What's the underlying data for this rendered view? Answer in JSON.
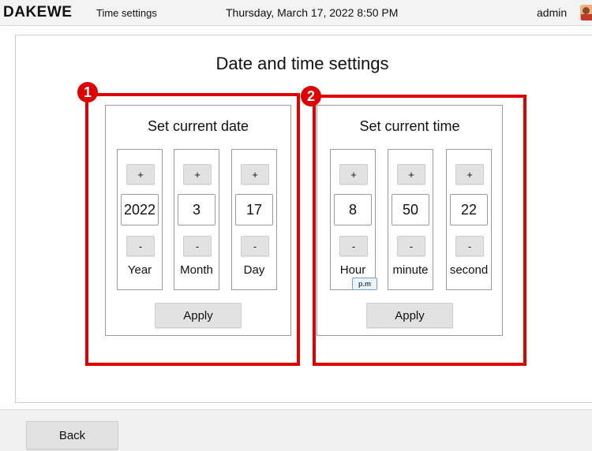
{
  "header": {
    "logo": "DAKEWE",
    "screen_name": "Time settings",
    "datetime": "Thursday, March 17, 2022  8:50 PM",
    "user": "admin",
    "avatar_icon": "user-avatar-icon"
  },
  "page": {
    "title": "Date and time settings"
  },
  "date_panel": {
    "title": "Set current date",
    "columns": [
      {
        "plus": "+",
        "value": "2022",
        "minus": "-",
        "label": "Year"
      },
      {
        "plus": "+",
        "value": "3",
        "minus": "-",
        "label": "Month"
      },
      {
        "plus": "+",
        "value": "17",
        "minus": "-",
        "label": "Day"
      }
    ],
    "apply": "Apply"
  },
  "time_panel": {
    "title": "Set current time",
    "columns": [
      {
        "plus": "+",
        "value": "8",
        "minus": "-",
        "label": "Hour"
      },
      {
        "plus": "+",
        "value": "50",
        "minus": "-",
        "label": "minute"
      },
      {
        "plus": "+",
        "value": "22",
        "minus": "-",
        "label": "second"
      }
    ],
    "ampm": "p.m",
    "apply": "Apply"
  },
  "callouts": {
    "one": "1",
    "two": "2",
    "color": "#e00000"
  },
  "footer": {
    "back": "Back"
  }
}
